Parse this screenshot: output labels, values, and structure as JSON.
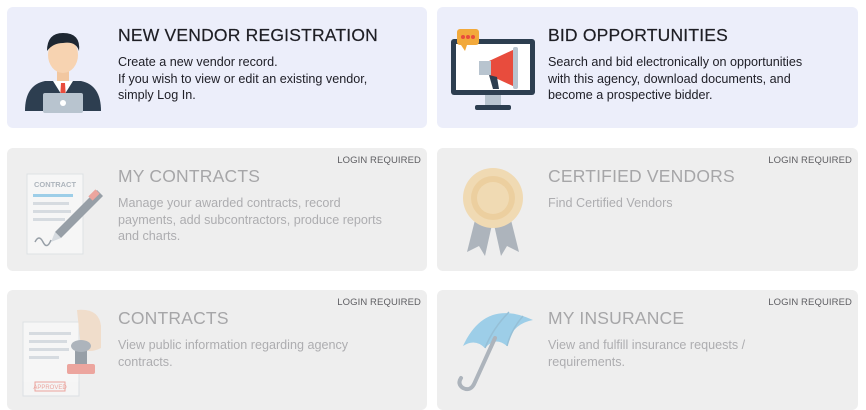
{
  "cards": [
    {
      "title": "NEW VENDOR REGISTRATION",
      "desc": [
        "Create a new vendor record.",
        "If you wish to view or edit an existing vendor,",
        "simply Log In."
      ],
      "icon": "vendor-person-icon",
      "locked": false
    },
    {
      "title": "BID OPPORTUNITIES",
      "desc": [
        "Search and bid electronically on opportunities",
        "with this agency, download documents, and",
        "become a prospective bidder."
      ],
      "icon": "megaphone-monitor-icon",
      "locked": false
    },
    {
      "title": "MY CONTRACTS",
      "desc": [
        "Manage your awarded contracts, record",
        "payments, add subcontractors, produce reports",
        "and charts."
      ],
      "icon": "contract-pen-icon",
      "icon_text": "CONTRACT",
      "locked": true,
      "badge": "LOGIN REQUIRED"
    },
    {
      "title": "CERTIFIED VENDORS",
      "desc": [
        "Find Certified Vendors"
      ],
      "icon": "award-seal-icon",
      "locked": true,
      "badge": "LOGIN REQUIRED"
    },
    {
      "title": "CONTRACTS",
      "desc": [
        "View public information regarding agency",
        "contracts."
      ],
      "icon": "approved-stamp-icon",
      "icon_text": "APPROVED",
      "locked": true,
      "badge": "LOGIN REQUIRED"
    },
    {
      "title": "MY INSURANCE",
      "desc": [
        "View and fulfill insurance requests /",
        "requirements."
      ],
      "icon": "umbrella-icon",
      "locked": true,
      "badge": "LOGIN REQUIRED"
    }
  ],
  "colors": {
    "active_bg": "#eceefa",
    "locked_bg": "#eeeeee",
    "accent_red": "#e84c3d",
    "accent_blue": "#3aa7e0",
    "gold": "#f2c16b"
  }
}
